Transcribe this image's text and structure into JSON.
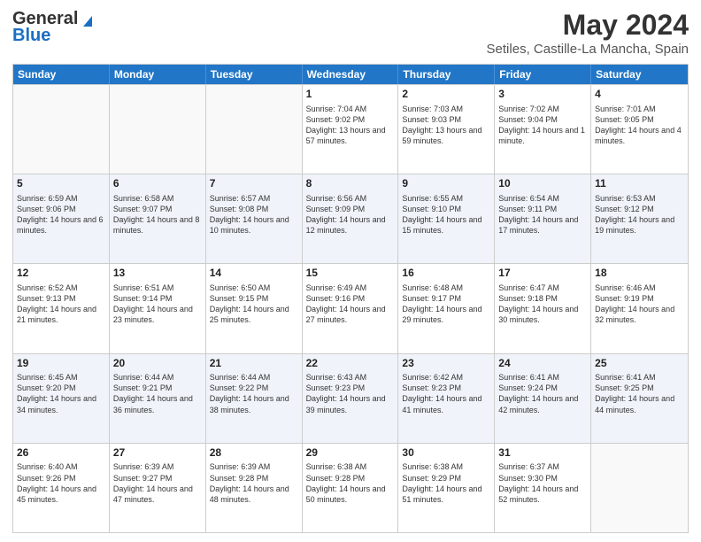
{
  "logo": {
    "line1": "General",
    "line2": "Blue"
  },
  "title": "May 2024",
  "subtitle": "Setiles, Castille-La Mancha, Spain",
  "days_of_week": [
    "Sunday",
    "Monday",
    "Tuesday",
    "Wednesday",
    "Thursday",
    "Friday",
    "Saturday"
  ],
  "weeks": [
    [
      {
        "day": "",
        "info": ""
      },
      {
        "day": "",
        "info": ""
      },
      {
        "day": "",
        "info": ""
      },
      {
        "day": "1",
        "info": "Sunrise: 7:04 AM\nSunset: 9:02 PM\nDaylight: 13 hours and 57 minutes."
      },
      {
        "day": "2",
        "info": "Sunrise: 7:03 AM\nSunset: 9:03 PM\nDaylight: 13 hours and 59 minutes."
      },
      {
        "day": "3",
        "info": "Sunrise: 7:02 AM\nSunset: 9:04 PM\nDaylight: 14 hours and 1 minute."
      },
      {
        "day": "4",
        "info": "Sunrise: 7:01 AM\nSunset: 9:05 PM\nDaylight: 14 hours and 4 minutes."
      }
    ],
    [
      {
        "day": "5",
        "info": "Sunrise: 6:59 AM\nSunset: 9:06 PM\nDaylight: 14 hours and 6 minutes."
      },
      {
        "day": "6",
        "info": "Sunrise: 6:58 AM\nSunset: 9:07 PM\nDaylight: 14 hours and 8 minutes."
      },
      {
        "day": "7",
        "info": "Sunrise: 6:57 AM\nSunset: 9:08 PM\nDaylight: 14 hours and 10 minutes."
      },
      {
        "day": "8",
        "info": "Sunrise: 6:56 AM\nSunset: 9:09 PM\nDaylight: 14 hours and 12 minutes."
      },
      {
        "day": "9",
        "info": "Sunrise: 6:55 AM\nSunset: 9:10 PM\nDaylight: 14 hours and 15 minutes."
      },
      {
        "day": "10",
        "info": "Sunrise: 6:54 AM\nSunset: 9:11 PM\nDaylight: 14 hours and 17 minutes."
      },
      {
        "day": "11",
        "info": "Sunrise: 6:53 AM\nSunset: 9:12 PM\nDaylight: 14 hours and 19 minutes."
      }
    ],
    [
      {
        "day": "12",
        "info": "Sunrise: 6:52 AM\nSunset: 9:13 PM\nDaylight: 14 hours and 21 minutes."
      },
      {
        "day": "13",
        "info": "Sunrise: 6:51 AM\nSunset: 9:14 PM\nDaylight: 14 hours and 23 minutes."
      },
      {
        "day": "14",
        "info": "Sunrise: 6:50 AM\nSunset: 9:15 PM\nDaylight: 14 hours and 25 minutes."
      },
      {
        "day": "15",
        "info": "Sunrise: 6:49 AM\nSunset: 9:16 PM\nDaylight: 14 hours and 27 minutes."
      },
      {
        "day": "16",
        "info": "Sunrise: 6:48 AM\nSunset: 9:17 PM\nDaylight: 14 hours and 29 minutes."
      },
      {
        "day": "17",
        "info": "Sunrise: 6:47 AM\nSunset: 9:18 PM\nDaylight: 14 hours and 30 minutes."
      },
      {
        "day": "18",
        "info": "Sunrise: 6:46 AM\nSunset: 9:19 PM\nDaylight: 14 hours and 32 minutes."
      }
    ],
    [
      {
        "day": "19",
        "info": "Sunrise: 6:45 AM\nSunset: 9:20 PM\nDaylight: 14 hours and 34 minutes."
      },
      {
        "day": "20",
        "info": "Sunrise: 6:44 AM\nSunset: 9:21 PM\nDaylight: 14 hours and 36 minutes."
      },
      {
        "day": "21",
        "info": "Sunrise: 6:44 AM\nSunset: 9:22 PM\nDaylight: 14 hours and 38 minutes."
      },
      {
        "day": "22",
        "info": "Sunrise: 6:43 AM\nSunset: 9:23 PM\nDaylight: 14 hours and 39 minutes."
      },
      {
        "day": "23",
        "info": "Sunrise: 6:42 AM\nSunset: 9:23 PM\nDaylight: 14 hours and 41 minutes."
      },
      {
        "day": "24",
        "info": "Sunrise: 6:41 AM\nSunset: 9:24 PM\nDaylight: 14 hours and 42 minutes."
      },
      {
        "day": "25",
        "info": "Sunrise: 6:41 AM\nSunset: 9:25 PM\nDaylight: 14 hours and 44 minutes."
      }
    ],
    [
      {
        "day": "26",
        "info": "Sunrise: 6:40 AM\nSunset: 9:26 PM\nDaylight: 14 hours and 45 minutes."
      },
      {
        "day": "27",
        "info": "Sunrise: 6:39 AM\nSunset: 9:27 PM\nDaylight: 14 hours and 47 minutes."
      },
      {
        "day": "28",
        "info": "Sunrise: 6:39 AM\nSunset: 9:28 PM\nDaylight: 14 hours and 48 minutes."
      },
      {
        "day": "29",
        "info": "Sunrise: 6:38 AM\nSunset: 9:28 PM\nDaylight: 14 hours and 50 minutes."
      },
      {
        "day": "30",
        "info": "Sunrise: 6:38 AM\nSunset: 9:29 PM\nDaylight: 14 hours and 51 minutes."
      },
      {
        "day": "31",
        "info": "Sunrise: 6:37 AM\nSunset: 9:30 PM\nDaylight: 14 hours and 52 minutes."
      },
      {
        "day": "",
        "info": ""
      }
    ]
  ]
}
